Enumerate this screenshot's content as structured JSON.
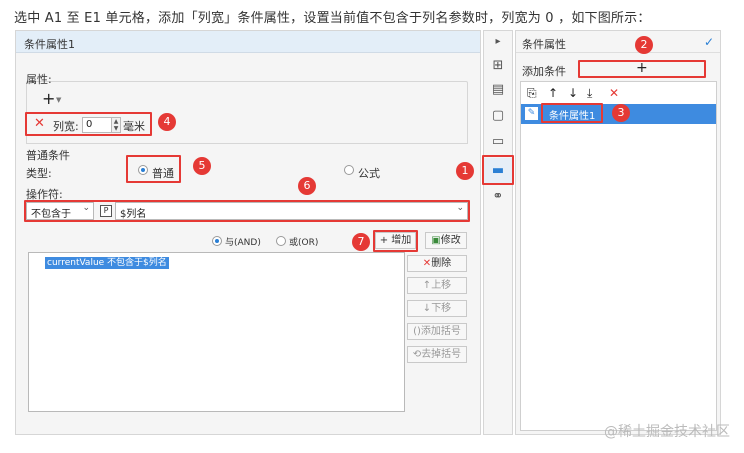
{
  "caption": "选中 A1 至 E1 单元格，添加「列宽」条件属性，设置当前值不包含于列名参数时，列宽为 0 ，如下图所示：",
  "dialog": {
    "title": "条件属性1",
    "attr_label": "属性:",
    "width_label": "列宽:",
    "width_value": "0",
    "width_unit": "毫米",
    "normal_cond_label": "普通条件",
    "type_label": "类型:",
    "type_normal": "普通",
    "type_formula": "公式",
    "operator_label": "操作符:",
    "operator_value": "不包含于",
    "param_icon": "P",
    "param_value": "$列名",
    "and_label": "与(AND)",
    "or_label": "或(OR)",
    "add_button": "增加",
    "modify_button": "修改",
    "delete_button": "删除",
    "up_button": "上移",
    "down_button": "下移",
    "add_bracket_button": "添加括号",
    "remove_bracket_button": "去掉括号",
    "condition_item": "currentValue 不包含于$列名"
  },
  "right_panel": {
    "title": "条件属性",
    "add_condition_label": "添加条件",
    "item_label": "条件属性1"
  },
  "badges": [
    "1",
    "2",
    "3",
    "4",
    "5",
    "6",
    "7"
  ],
  "watermark": "@稀土掘金技术社区",
  "colors": {
    "annotation_red": "#e53935",
    "selection_blue": "#3e8be0"
  }
}
